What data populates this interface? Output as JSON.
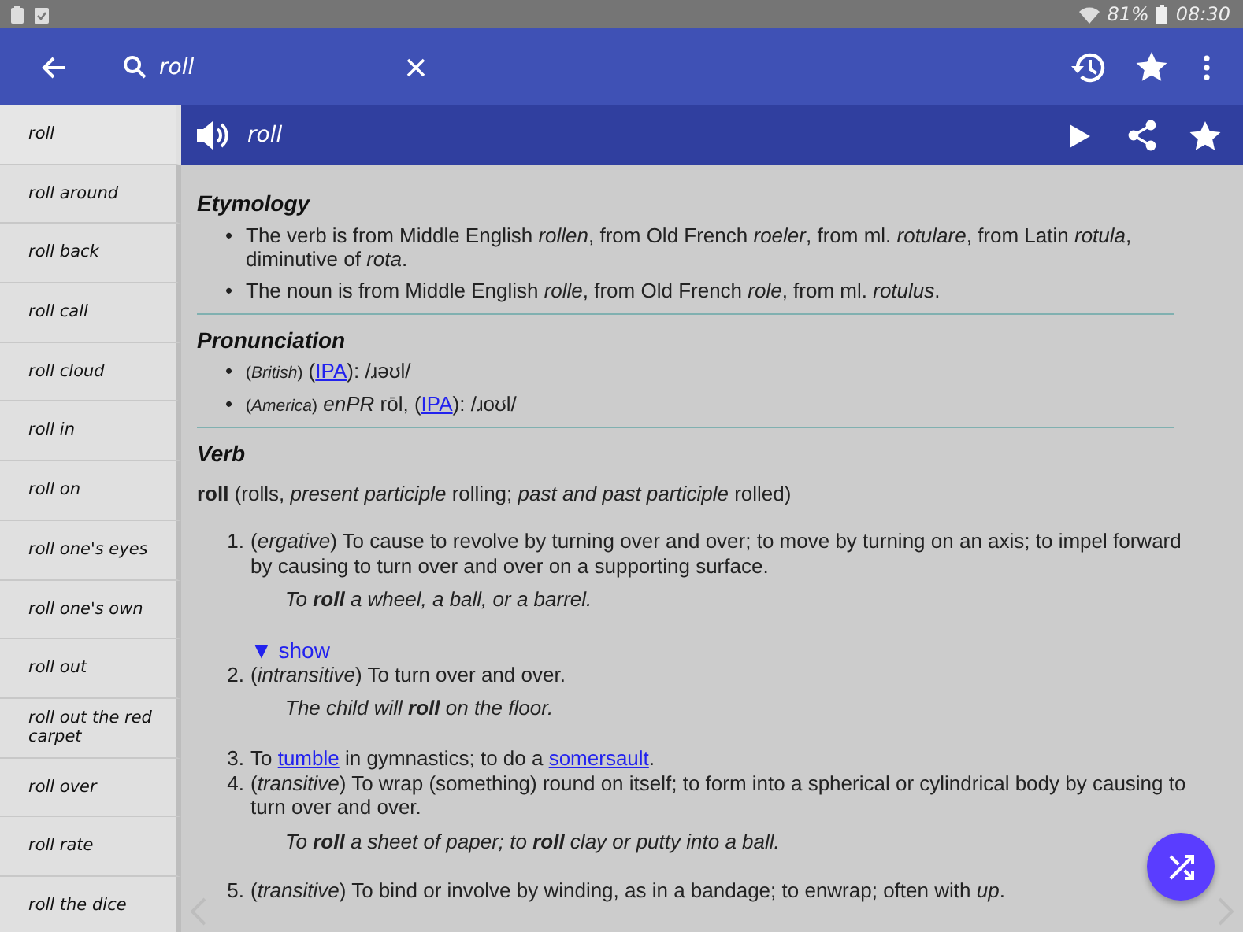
{
  "status_bar": {
    "battery": "81%",
    "time": "08:30"
  },
  "search": {
    "value": "roll"
  },
  "word_list": [
    {
      "label": "roll",
      "selected": true
    },
    {
      "label": "roll around",
      "selected": false
    },
    {
      "label": "roll back",
      "selected": false
    },
    {
      "label": "roll call",
      "selected": false
    },
    {
      "label": "roll cloud",
      "selected": false
    },
    {
      "label": "roll in",
      "selected": false
    },
    {
      "label": "roll on",
      "selected": false
    },
    {
      "label": "roll one's eyes",
      "selected": false
    },
    {
      "label": "roll one's own",
      "selected": false
    },
    {
      "label": "roll out",
      "selected": false
    },
    {
      "label": "roll out the red carpet",
      "selected": false
    },
    {
      "label": "roll over",
      "selected": false
    },
    {
      "label": "roll rate",
      "selected": false
    },
    {
      "label": "roll the dice",
      "selected": false
    }
  ],
  "entry": {
    "headword": "roll",
    "etymology": {
      "title": "Etymology",
      "items": [
        {
          "marker": "•",
          "text": "The verb is from Middle English *rollen*, from Old French *roeler*, from ml. *rotulare*, from Latin *rotula*, diminutive of *rota*."
        },
        {
          "marker": "•",
          "text": "The noun is from Middle English *rolle*, from Old French *role*, from ml. *rotulus*."
        }
      ]
    },
    "pronunciation": {
      "title": "Pronunciation",
      "items": [
        {
          "marker": "•",
          "segments": [
            {
              "kind": "qualifier",
              "text": "(*British*)"
            },
            {
              "kind": "text",
              "text": " ("
            },
            {
              "kind": "link",
              "text": "IPA"
            },
            {
              "kind": "text",
              "text": "): /ɹəʊl/"
            }
          ]
        },
        {
          "marker": "•",
          "segments": [
            {
              "kind": "qualifier",
              "text": "(*America*)"
            },
            {
              "kind": "text",
              "text": " *enPR* rōl, ("
            },
            {
              "kind": "link",
              "text": "IPA"
            },
            {
              "kind": "text",
              "text": "): /ɹoʊl/"
            }
          ]
        }
      ]
    },
    "verb": {
      "title": "Verb",
      "forms": "**roll** (rolls, *present participle* rolling; *past and past participle* rolled)",
      "senses": [
        {
          "number": "1.",
          "segments": [
            {
              "kind": "text",
              "text": "(*ergative*) To cause to revolve by turning over and over; to move by turning on an axis; to impel forward by causing to turn over and over on a supporting surface."
            }
          ],
          "examples": [
            "To **roll** a wheel, a ball, or a barrel."
          ],
          "toggle": "▼ show"
        },
        {
          "number": "2.",
          "segments": [
            {
              "kind": "text",
              "text": "(*intransitive*) To turn over and over."
            }
          ],
          "examples": [
            "The child will **roll** on the floor."
          ]
        },
        {
          "number": "3.",
          "segments": [
            {
              "kind": "text",
              "text": "To "
            },
            {
              "kind": "link",
              "text": "tumble"
            },
            {
              "kind": "text",
              "text": " in gymnastics; to do a "
            },
            {
              "kind": "link",
              "text": "somersault"
            },
            {
              "kind": "text",
              "text": "."
            }
          ]
        },
        {
          "number": "4.",
          "segments": [
            {
              "kind": "text",
              "text": "(*transitive*) To wrap (something) round on itself; to form into a spherical or cylindrical body by causing to turn over and over."
            }
          ],
          "examples": [
            "To **roll** a sheet of paper; to **roll** clay or putty into a ball."
          ]
        },
        {
          "number": "5.",
          "segments": [
            {
              "kind": "text",
              "text": "(*transitive*) To bind or involve by winding, as in a bandage; to enwrap; often with *up*."
            }
          ]
        }
      ]
    }
  }
}
